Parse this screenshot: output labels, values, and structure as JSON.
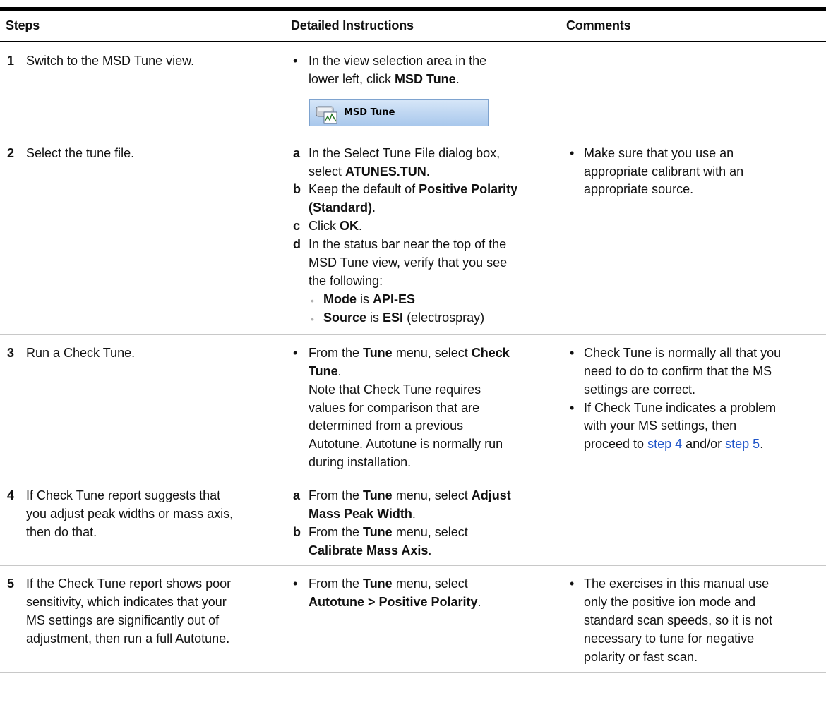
{
  "headers": {
    "steps": "Steps",
    "detailed": "Detailed Instructions",
    "comments": "Comments"
  },
  "rows": [
    {
      "num": "1",
      "step": "Switch to the MSD Tune view.",
      "instr": {
        "bullet": "•",
        "l1": "In the view selection area in the",
        "l2_pre": "lower left, click ",
        "l2_bold": "MSD Tune",
        "l2_post": "."
      },
      "button_label": "MSD Tune",
      "button_icon": "msd-tune-icon"
    },
    {
      "num": "2",
      "step": "Select the tune file.",
      "a": {
        "letter": "a",
        "l1": "In the Select Tune File dialog box,",
        "l2_pre": "select ",
        "l2_bold": "ATUNES.TUN",
        "l2_post": "."
      },
      "b": {
        "letter": "b",
        "l1_pre": "Keep the default of ",
        "l1_bold": "Positive Polarity",
        "l2_bold": "(Standard)",
        "l2_post": "."
      },
      "c": {
        "letter": "c",
        "pre": "Click ",
        "bold": "OK",
        "post": "."
      },
      "d": {
        "letter": "d",
        "l1": "In the status bar near the top of the",
        "l2": "MSD Tune view, verify that you see",
        "l3": "the following:",
        "s1_bold1": "Mode",
        "s1_mid": " is ",
        "s1_bold2": "API-ES",
        "s2_bold1": "Source",
        "s2_mid": " is ",
        "s2_bold2": "ESI",
        "s2_post": " (electrospray)"
      },
      "comment": {
        "l1": "Make sure that you use an",
        "l2": "appropriate calibrant with an",
        "l3": "appropriate source."
      }
    },
    {
      "num": "3",
      "step": "Run a Check Tune.",
      "instr": {
        "l1_pre": "From the ",
        "l1_b1": "Tune",
        "l1_mid": " menu, select ",
        "l1_b2": "Check",
        "l2_bold": "Tune",
        "l2_post": ".",
        "l3": "Note that Check Tune requires",
        "l4": "values for comparison that are",
        "l5": "determined from a previous",
        "l6": "Autotune. Autotune is normally run",
        "l7": "during installation."
      },
      "c1": {
        "l1": "Check Tune is normally all that you",
        "l2": "need to do to confirm that the MS",
        "l3": "settings are correct."
      },
      "c2": {
        "l1": "If Check Tune indicates a problem",
        "l2": "with your MS settings, then",
        "l3_pre": "proceed to ",
        "link1": "step 4",
        "l3_mid": " and/or ",
        "link2": "step 5",
        "l3_post": "."
      }
    },
    {
      "num": "4",
      "step_l1": "If Check Tune report suggests that",
      "step_l2": "you adjust peak widths or mass axis,",
      "step_l3": "then do that.",
      "a": {
        "letter": "a",
        "pre": "From the ",
        "b1": "Tune",
        "mid": " menu, select ",
        "b2": "Adjust",
        "l2_bold": "Mass Peak Width",
        "l2_post": "."
      },
      "b": {
        "letter": "b",
        "pre": "From the ",
        "b1": "Tune",
        "mid": " menu, select",
        "l2_bold": "Calibrate Mass Axis",
        "l2_post": "."
      }
    },
    {
      "num": "5",
      "step_l1": "If the Check Tune report shows poor",
      "step_l2": "sensitivity, which indicates that your",
      "step_l3": "MS settings are significantly out of",
      "step_l4": "adjustment, then run a full Autotune.",
      "instr": {
        "pre": "From the ",
        "b1": "Tune",
        "mid": " menu, select",
        "l2_bold": "Autotune > Positive Polarity",
        "l2_post": "."
      },
      "comment": {
        "l1": "The exercises in this manual use",
        "l2": "only the positive ion mode and",
        "l3": "standard scan speeds, so it is not",
        "l4": "necessary to tune for negative",
        "l5": "polarity or fast scan."
      }
    }
  ]
}
